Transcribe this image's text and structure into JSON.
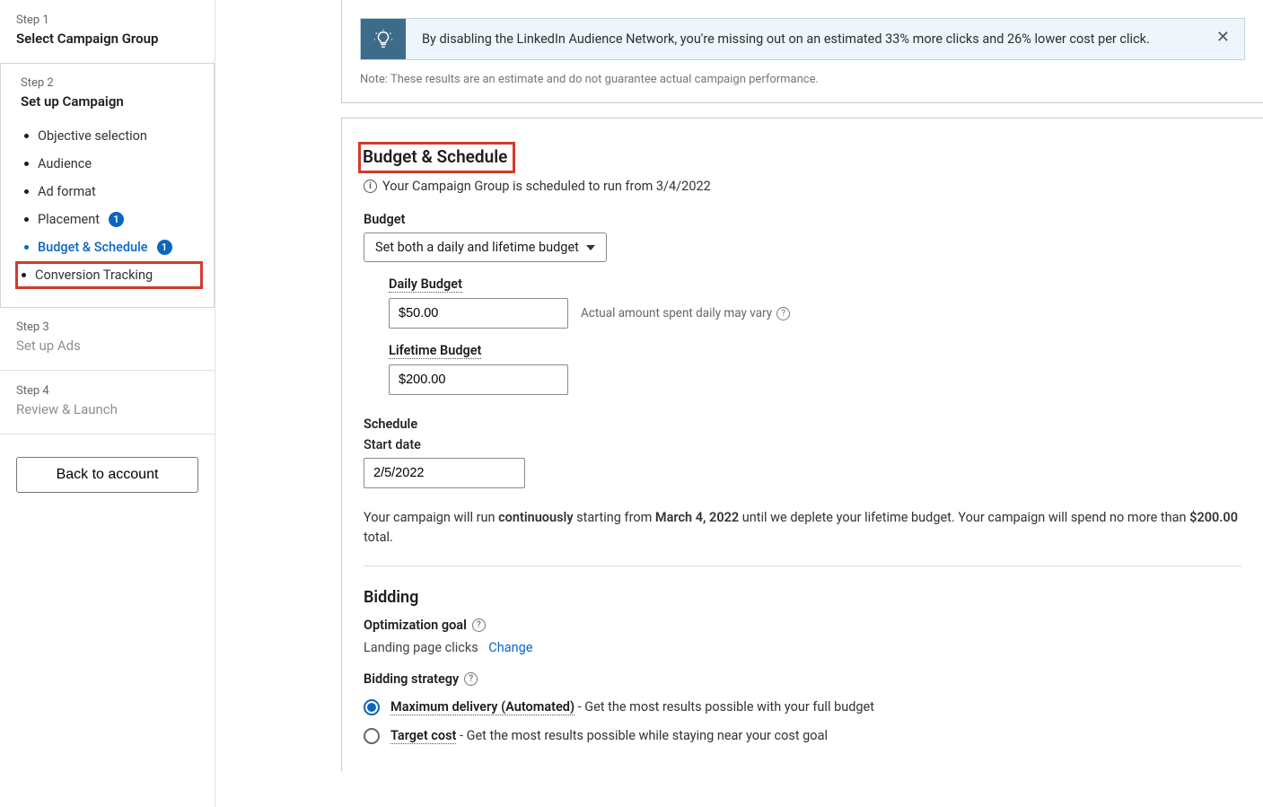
{
  "sidebar": {
    "step1": {
      "label": "Step 1",
      "title": "Select Campaign Group"
    },
    "step2": {
      "label": "Step 2",
      "title": "Set up Campaign",
      "items": [
        {
          "label": "Objective selection"
        },
        {
          "label": "Audience"
        },
        {
          "label": "Ad format"
        },
        {
          "label": "Placement",
          "badge": "1"
        },
        {
          "label": "Budget & Schedule",
          "badge": "1",
          "active": true
        },
        {
          "label": "Conversion Tracking",
          "highlight": true
        }
      ]
    },
    "step3": {
      "label": "Step 3",
      "title": "Set up Ads"
    },
    "step4": {
      "label": "Step 4",
      "title": "Review & Launch"
    },
    "back_button": "Back to account"
  },
  "alert": {
    "text": "By disabling the LinkedIn Audience Network, you're missing out on an estimated 33% more clicks and 26% lower cost per click.",
    "note": "Note: These results are an estimate and do not guarantee actual campaign performance."
  },
  "budget": {
    "heading": "Budget & Schedule",
    "info": "Your Campaign Group is scheduled to run from 3/4/2022",
    "label": "Budget",
    "select_value": "Set both a daily and lifetime budget",
    "daily_label": "Daily Budget",
    "daily_value": "$50.00",
    "daily_hint": "Actual amount spent daily may vary",
    "lifetime_label": "Lifetime Budget",
    "lifetime_value": "$200.00"
  },
  "schedule": {
    "label": "Schedule",
    "start_date_label": "Start date",
    "start_date_value": "2/5/2022",
    "run_prefix": "Your campaign will run ",
    "run_bold1": "continuously",
    "run_mid1": " starting from ",
    "run_bold2": "March 4, 2022",
    "run_mid2": " until we deplete your lifetime budget. Your campaign will spend no more than ",
    "run_bold3": "$200.00",
    "run_suffix": " total."
  },
  "bidding": {
    "heading": "Bidding",
    "opt_goal_label": "Optimization goal",
    "opt_goal_value": "Landing page clicks",
    "change_label": "Change",
    "strategy_label": "Bidding strategy",
    "radio1_label": "Maximum delivery (Automated)",
    "radio1_desc": " - Get the most results possible with your full budget",
    "radio2_label": "Target cost",
    "radio2_desc": " - Get the most results possible while staying near your cost goal"
  }
}
